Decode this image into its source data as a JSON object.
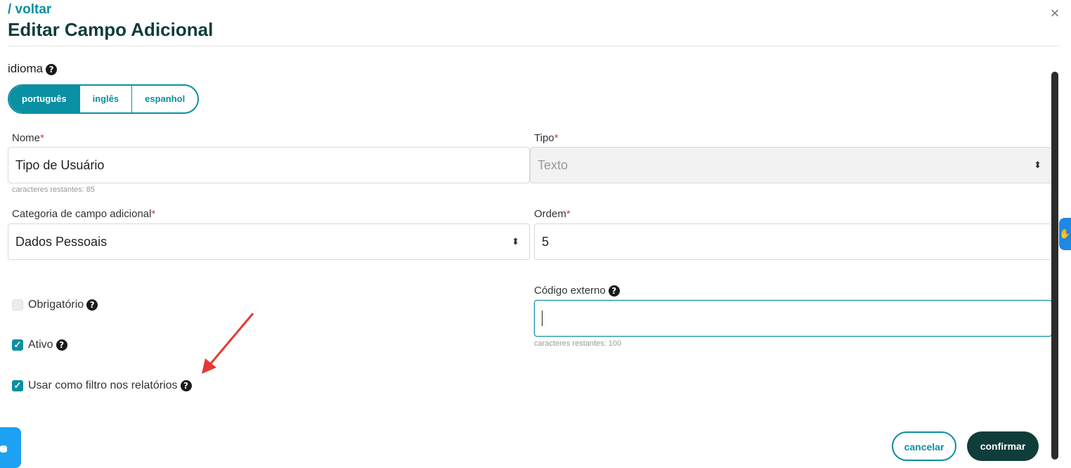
{
  "header": {
    "back_label": "/ voltar",
    "title": "Editar Campo Adicional",
    "close_symbol": "×"
  },
  "language": {
    "label": "idioma",
    "options": [
      {
        "label": "português",
        "active": true
      },
      {
        "label": "inglês",
        "active": false
      },
      {
        "label": "espanhol",
        "active": false
      }
    ]
  },
  "form": {
    "nome": {
      "label": "Nome",
      "required_mark": "*",
      "value": "Tipo de Usuário",
      "hint": "caracteres restantes: 85"
    },
    "tipo": {
      "label": "Tipo",
      "required_mark": "*",
      "value": "Texto"
    },
    "categoria": {
      "label": "Categoria de campo adicional",
      "required_mark": "*",
      "value": "Dados Pessoais"
    },
    "ordem": {
      "label": "Ordem",
      "required_mark": "*",
      "value": "5"
    },
    "codigo_externo": {
      "label": "Código externo",
      "value": "",
      "hint": "caracteres restantes: 100"
    }
  },
  "checkboxes": {
    "obrigatorio": {
      "label": "Obrigatório",
      "checked": false
    },
    "ativo": {
      "label": "Ativo",
      "checked": true
    },
    "filtro": {
      "label": "Usar como filtro nos relatórios",
      "checked": true
    }
  },
  "actions": {
    "cancel_label": "cancelar",
    "confirm_label": "confirmar"
  },
  "icons": {
    "help": "?",
    "checkmark": "✓",
    "select_caret": "⬍"
  },
  "colors": {
    "accent": "#0a8fa3",
    "dark": "#0f3d3a",
    "required": "#e53935",
    "annotation_arrow": "#e53935"
  }
}
